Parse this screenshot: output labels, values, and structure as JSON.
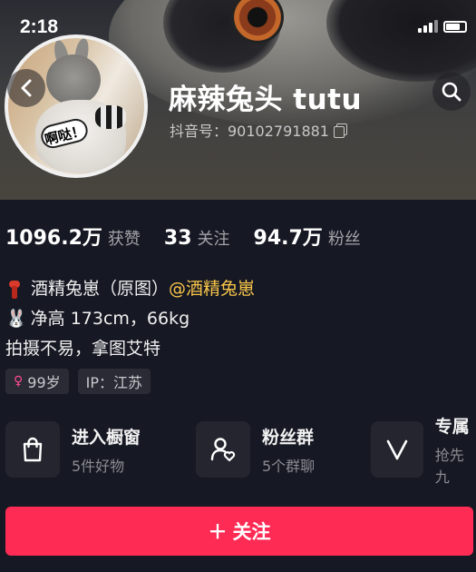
{
  "status_bar": {
    "time": "2:18"
  },
  "header": {
    "nickname": "麻辣兔头 tutu",
    "douyin_id": "抖音号：90102791881",
    "avatar_sticker_text": "啊哒！"
  },
  "stats": [
    {
      "value": "1096.2万",
      "label": "获赞"
    },
    {
      "value": "33",
      "label": "关注"
    },
    {
      "value": "94.7万",
      "label": "粉丝"
    }
  ],
  "bio": {
    "line1_text": "酒精兔崽（原图）",
    "line1_mention": "@酒精兔崽",
    "line2_text": "净高 173cm，66kg",
    "line3_text": "拍摄不易，拿图艾特"
  },
  "tags": {
    "age": "99岁",
    "ip": "IP：江苏"
  },
  "cards": [
    {
      "title": "进入橱窗",
      "subtitle": "5件好物",
      "icon": "shopping-bag-icon"
    },
    {
      "title": "粉丝群",
      "subtitle": "5个群聊",
      "icon": "fan-group-icon"
    },
    {
      "title": "专属",
      "subtitle": "抢先九",
      "icon": "v-badge-icon"
    }
  ],
  "follow_button": {
    "label": "关注",
    "color": "#fe2c55"
  },
  "colors": {
    "background": "#161823",
    "mention": "#f9c64a",
    "female_icon": "#ff4d8d"
  }
}
